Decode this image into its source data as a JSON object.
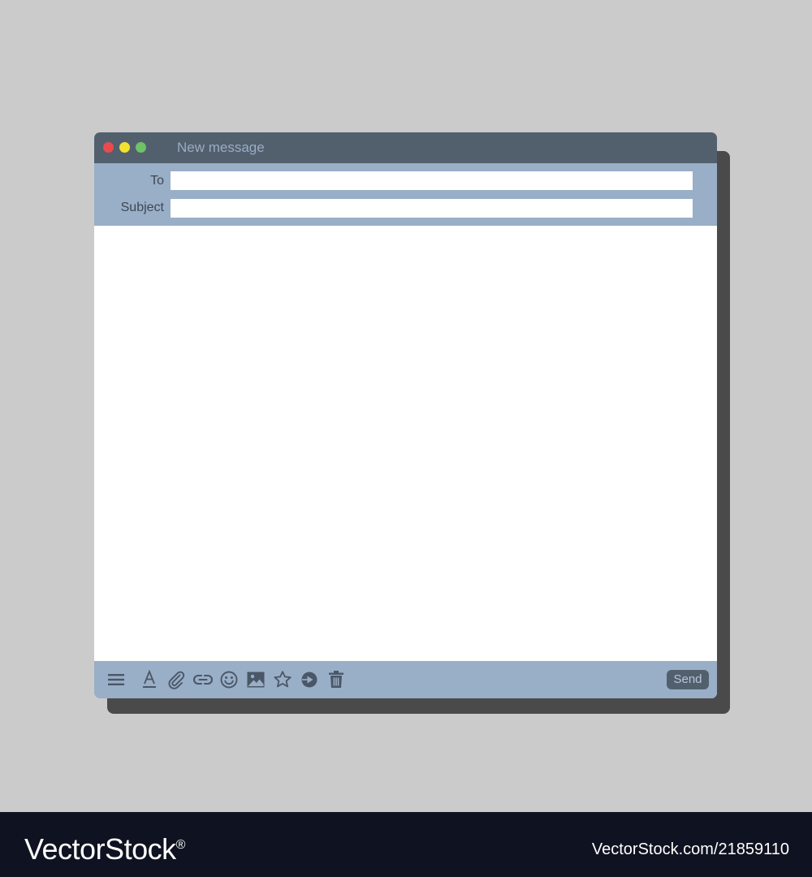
{
  "window": {
    "title": "New message"
  },
  "fields": {
    "to_label": "To",
    "to_value": "",
    "subject_label": "Subject",
    "subject_value": ""
  },
  "body": {
    "value": ""
  },
  "toolbar": {
    "icons": [
      "menu-icon",
      "text-format-icon",
      "attachment-icon",
      "link-icon",
      "emoji-icon",
      "image-icon",
      "star-icon",
      "drive-icon",
      "trash-icon"
    ],
    "send_label": "Send"
  },
  "watermark": {
    "brand": "VectorStock",
    "registered": "®",
    "image_id": "VectorStock.com/21859110"
  },
  "colors": {
    "background": "#cbcbcb",
    "titlebar": "#52606e",
    "panel": "#99aec7",
    "icon": "#4a5766",
    "close": "#ea4a4f",
    "minimize": "#f1e22f",
    "maximize": "#6ec267"
  }
}
